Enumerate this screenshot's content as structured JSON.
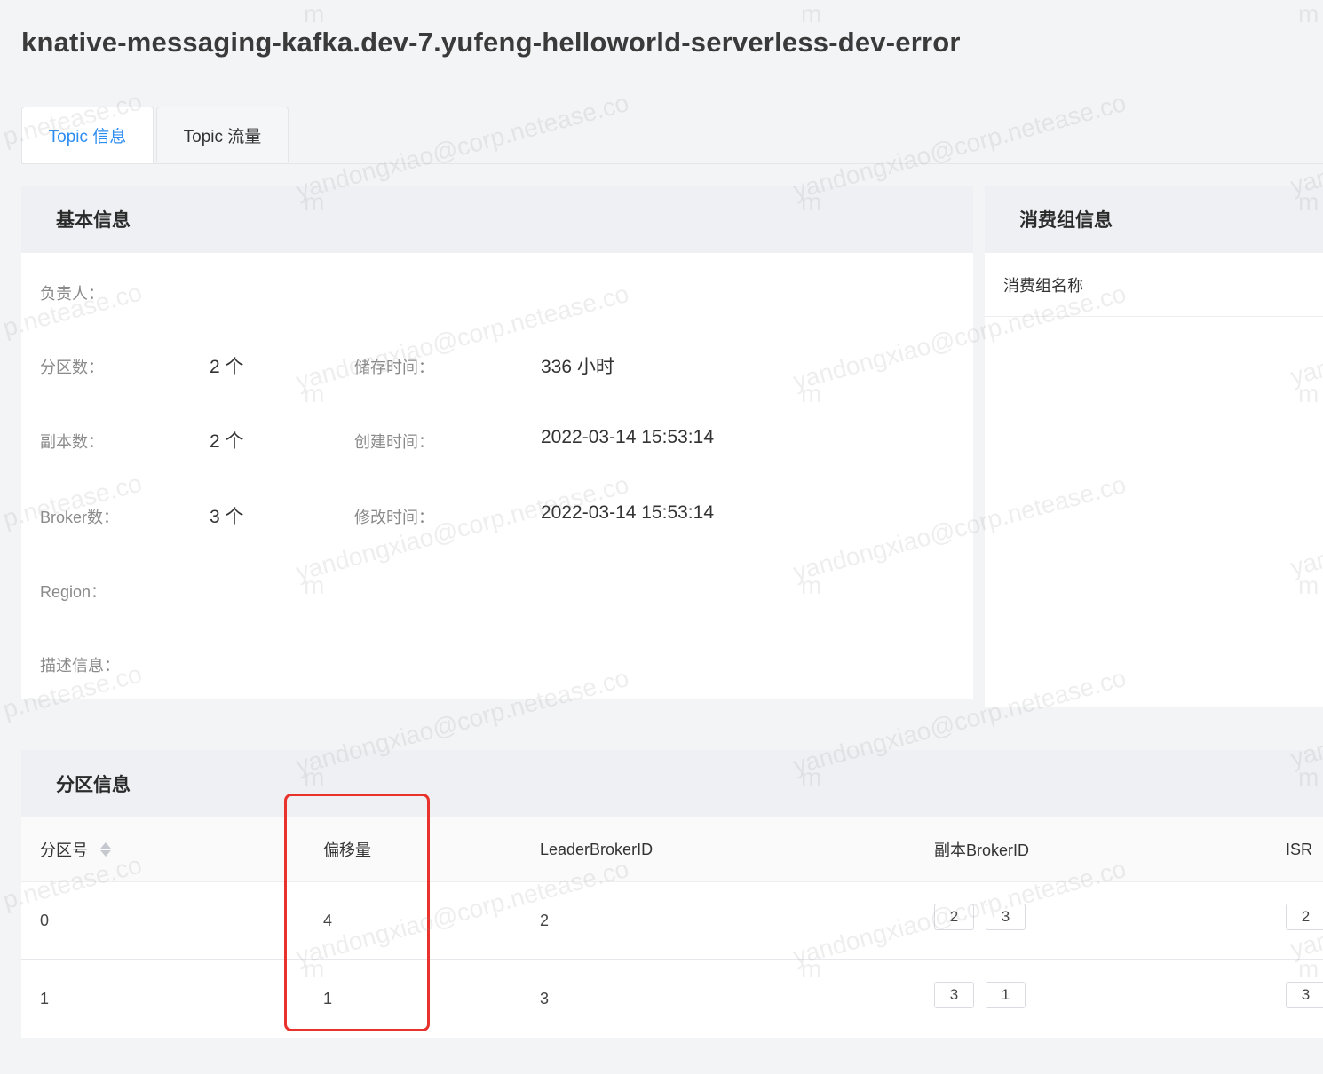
{
  "page": {
    "title": "knative-messaging-kafka.dev-7.yufeng-helloworld-serverless-dev-error"
  },
  "tabs": [
    {
      "label": "Topic 信息",
      "active": true
    },
    {
      "label": "Topic 流量",
      "active": false
    }
  ],
  "basic_info": {
    "title": "基本信息",
    "owner_label": "负责人：",
    "owner_value": "",
    "partitions_label": "分区数：",
    "partitions_value": "2 个",
    "replicas_label": "副本数：",
    "replicas_value": "2 个",
    "brokers_label": "Broker数：",
    "brokers_value": "3 个",
    "region_label": "Region：",
    "region_value": "",
    "description_label": "描述信息：",
    "description_value": "",
    "retention_label": "储存时间：",
    "retention_value": "336 小时",
    "created_label": "创建时间：",
    "created_value": "2022-03-14 15:53:14",
    "modified_label": "修改时间：",
    "modified_value": "2022-03-14 15:53:14"
  },
  "consumer_info": {
    "title": "消费组信息",
    "column": "消费组名称"
  },
  "partition_info": {
    "title": "分区信息",
    "columns": [
      "分区号",
      "偏移量",
      "LeaderBrokerID",
      "副本BrokerID",
      "ISR"
    ],
    "rows": [
      {
        "partition": "0",
        "offset": "4",
        "leader": "2",
        "replicas": [
          "2",
          "3"
        ],
        "isr": [
          "2"
        ]
      },
      {
        "partition": "1",
        "offset": "1",
        "leader": "3",
        "replicas": [
          "3",
          "1"
        ],
        "isr": [
          "3"
        ]
      }
    ]
  },
  "watermark": {
    "handle": "yandongxiao@corp.netease.co",
    "fragment": "m",
    "partial": "p.netease.co",
    "edge": "yan"
  },
  "colors": {
    "accent": "#2d8cf0",
    "highlight": "#e9322c"
  }
}
